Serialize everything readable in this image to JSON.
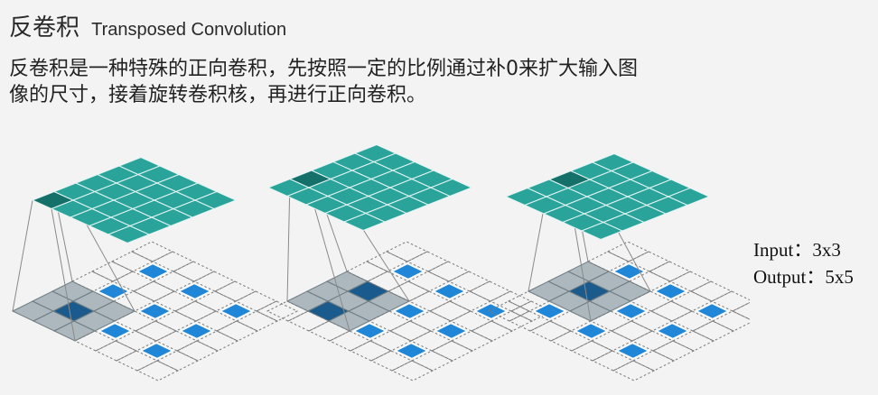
{
  "title": {
    "cn": "反卷积",
    "en": "Transposed Convolution"
  },
  "description": "反卷积是一种特殊的正向卷积，先按照一定的比例通过补0来扩大输入图像的尺寸，接着旋转卷积核，再进行正向卷积。",
  "io": {
    "input": "Input：3x3",
    "output": "Output：5x5"
  },
  "colors": {
    "output_cell": "#2aa39b",
    "output_cell_dark": "#16706a",
    "input_cell": "#1f86d8",
    "kernel_cell": "#a4b1b7",
    "kernel_overlap": "#1b5a8c",
    "grid_dash": "#777777"
  },
  "diagram": {
    "output_size": 5,
    "padded_size": 7,
    "input_cells": [
      [
        1,
        1
      ],
      [
        1,
        3
      ],
      [
        1,
        5
      ],
      [
        3,
        1
      ],
      [
        3,
        3
      ],
      [
        3,
        5
      ],
      [
        5,
        1
      ],
      [
        5,
        3
      ],
      [
        5,
        5
      ]
    ],
    "steps": [
      {
        "kernel_row": 0,
        "kernel_col": 0,
        "output_row": 0,
        "output_col": 0
      },
      {
        "kernel_row": 0,
        "kernel_col": 1,
        "output_row": 0,
        "output_col": 1
      },
      {
        "kernel_row": 0,
        "kernel_col": 2,
        "output_row": 0,
        "output_col": 2
      }
    ]
  }
}
